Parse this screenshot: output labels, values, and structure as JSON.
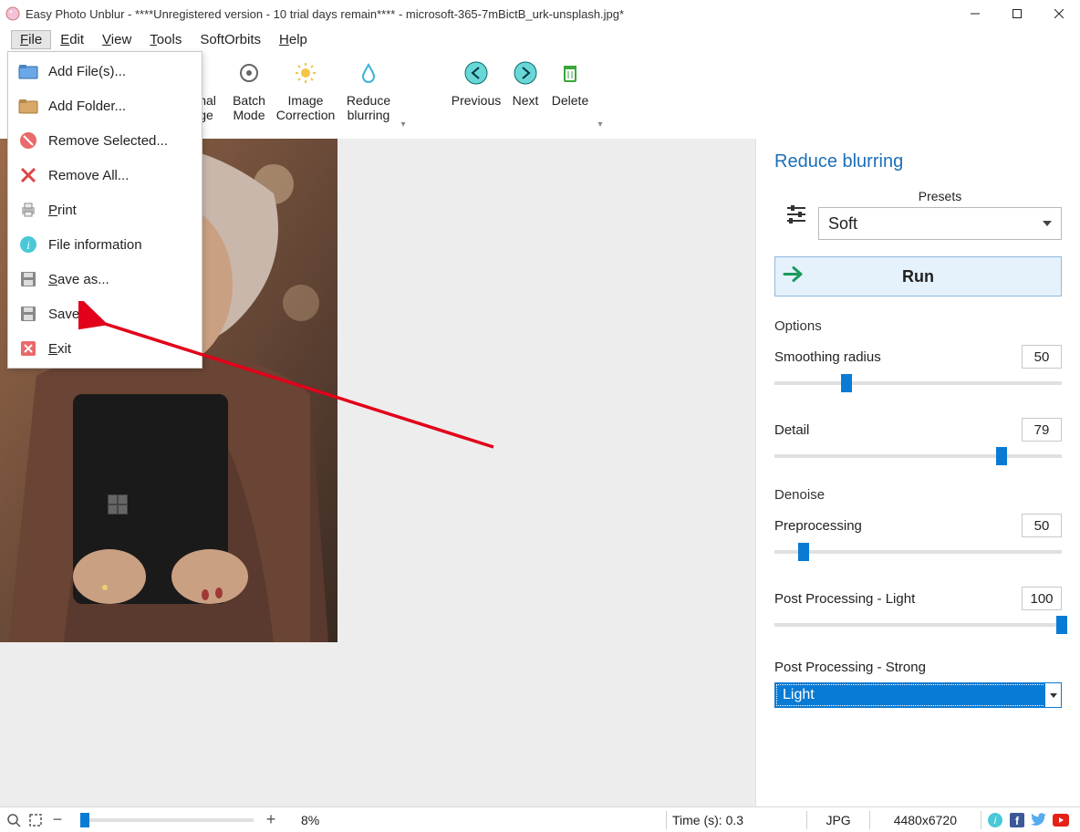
{
  "window": {
    "title": "Easy Photo Unblur - ****Unregistered version - 10 trial days remain**** - microsoft-365-7mBictB_urk-unsplash.jpg*"
  },
  "menubar": {
    "file": "File",
    "edit": "Edit",
    "view": "View",
    "tools": "Tools",
    "softorbits": "SoftOrbits",
    "help": "Help"
  },
  "toolbar": {
    "original_l1": "inal",
    "original_l2": "ge",
    "batch_l1": "Batch",
    "batch_l2": "Mode",
    "image_l1": "Image",
    "image_l2": "Correction",
    "reduce_l1": "Reduce",
    "reduce_l2": "blurring",
    "previous": "Previous",
    "next": "Next",
    "delete": "Delete"
  },
  "file_menu": {
    "add_files": "Add File(s)...",
    "add_folder": "Add Folder...",
    "remove_selected": "Remove Selected...",
    "remove_all": "Remove All...",
    "print": "Print",
    "file_info": "File information",
    "save_as": "Save as...",
    "save": "Save",
    "exit": "Exit"
  },
  "side": {
    "title": "Reduce blurring",
    "presets_label": "Presets",
    "presets_value": "Soft",
    "run": "Run",
    "options": "Options",
    "smoothing_label": "Smoothing radius",
    "smoothing_value": "50",
    "detail_label": "Detail",
    "detail_value": "79",
    "denoise_heading": "Denoise",
    "pre_label": "Preprocessing",
    "pre_value": "50",
    "ppl_label": "Post Processing - Light",
    "ppl_value": "100",
    "pps_label": "Post Processing - Strong",
    "pps_value": "Light"
  },
  "status": {
    "zoom_pct": "8%",
    "time": "Time (s): 0.3",
    "format": "JPG",
    "dims": "4480x6720"
  },
  "slider_positions": {
    "smoothing_pct": 25,
    "detail_pct": 79,
    "pre_pct": 10,
    "ppl_pct": 100
  }
}
